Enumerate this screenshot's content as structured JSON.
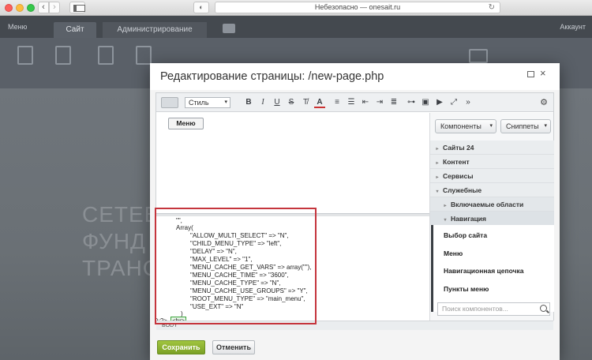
{
  "browser": {
    "url": "Небезопасно — onesait.ru",
    "privacy_icon": "shield-icon",
    "back_label": "‹",
    "forward_label": "›"
  },
  "bitrix": {
    "menu_label": "Меню",
    "tab_site": "Сайт",
    "tab_admin": "Администрирование",
    "account_label": "Аккаунт",
    "background_lines": [
      "СЕТЕВ",
      "ФУНД",
      "ТРАНС"
    ]
  },
  "dialog": {
    "title": "Редактирование страницы: /new-page.php",
    "close_label": "×"
  },
  "editor_toolbar": {
    "style_select": "Стиль",
    "style_arrow": "▾",
    "bold": "B",
    "italic": "I",
    "underline": "U",
    "strike": "S",
    "more": "»",
    "settings": "⚙"
  },
  "visual": {
    "menu_chip": "Меню"
  },
  "code": {
    "lines": [
      "\"\",",
      "Array(",
      "\"ALLOW_MULTI_SELECT\" => \"N\",",
      "\"CHILD_MENU_TYPE\" => \"left\",",
      "\"DELAY\" => \"N\",",
      "\"MAX_LEVEL\" => \"1\",",
      "\"MENU_CACHE_GET_VARS\" => array(\"\"),",
      "\"MENU_CACHE_TIME\" => \"3600\",",
      "\"MENU_CACHE_TYPE\" => \"N\",",
      "\"MENU_CACHE_USE_GROUPS\" => \"Y\",",
      "\"ROOT_MENU_TYPE\" => \"main_menu\",",
      "\"USE_EXT\" => \"N\"",
      ")"
    ],
    "last_line_prefix": ");?>",
    "br_tag": "<br>"
  },
  "right_panel": {
    "tab_components": "Компоненты",
    "tab_snippets": "Сниппеты",
    "tab_arrow": "▾",
    "tree": [
      {
        "label": "Сайты 24",
        "marker": "▸"
      },
      {
        "label": "Контент",
        "marker": "▸"
      },
      {
        "label": "Сервисы",
        "marker": "▸"
      },
      {
        "label": "Служебные",
        "marker": "▾"
      },
      {
        "label": "Включаемые области",
        "marker": "▸"
      },
      {
        "label": "Навигация",
        "marker": "▾"
      }
    ],
    "components": [
      "Выбор сайта",
      "Меню",
      "Навигационная цепочка",
      "Пункты меню"
    ],
    "search_placeholder": "Поиск компонентов..."
  },
  "status_bar": {
    "text": "BODY"
  },
  "buttons": {
    "save": "Сохранить",
    "cancel": "Отменить"
  }
}
